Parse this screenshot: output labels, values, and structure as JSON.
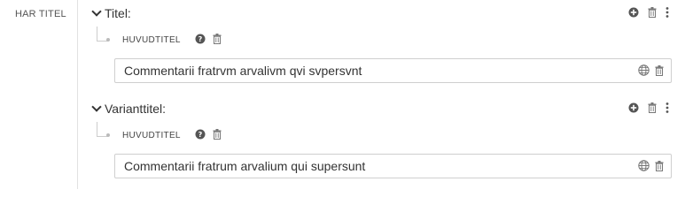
{
  "side_label": "HAR TITEL",
  "groups": [
    {
      "title": "Titel:",
      "sub_label": "HUVUDTITEL",
      "value": "Commentarii fratrvm arvalivm qvi svpersvnt"
    },
    {
      "title": "Varianttitel:",
      "sub_label": "HUVUDTITEL",
      "value": "Commentarii fratrum arvalium qui supersunt"
    }
  ],
  "icons": {
    "add": "plus-circle-icon",
    "delete": "trash-icon",
    "menu": "more-vertical-icon",
    "help": "question-circle-icon",
    "language": "globe-icon"
  },
  "colors": {
    "text": "#333333",
    "icon": "#555555",
    "border": "#cfcfcf"
  }
}
